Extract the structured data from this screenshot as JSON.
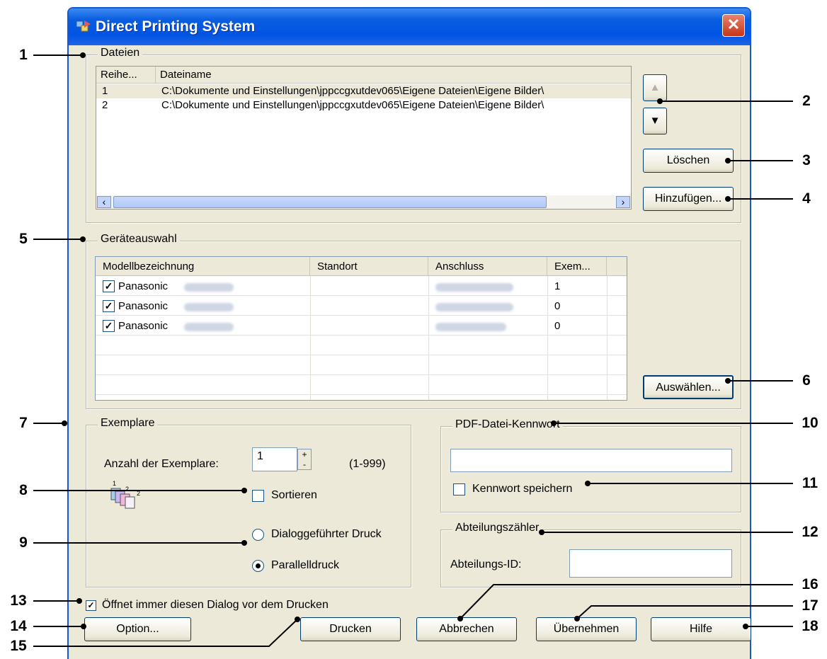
{
  "window": {
    "title": "Direct Printing System",
    "close": "✕"
  },
  "files": {
    "legend": "Dateien",
    "col_order": "Reihe...",
    "col_name": "Dateiname",
    "rows": [
      {
        "order": "1",
        "name": "C:\\Dokumente und Einstellungen\\jppccgxutdev065\\Eigene Dateien\\Eigene Bilder\\"
      },
      {
        "order": "2",
        "name": "C:\\Dokumente und Einstellungen\\jppccgxutdev065\\Eigene Dateien\\Eigene Bilder\\"
      }
    ],
    "scroll_left": "‹",
    "scroll_right": "›",
    "up": "▲",
    "down": "▼",
    "delete_label": "Löschen",
    "add_label": "Hinzufügen..."
  },
  "devices": {
    "legend": "Geräteauswahl",
    "cols": [
      "Modellbezeichnung",
      "Standort",
      "Anschluss",
      "Exem..."
    ],
    "rows": [
      {
        "model": "Panasonic",
        "copies": "1"
      },
      {
        "model": "Panasonic",
        "copies": "0"
      },
      {
        "model": "Panasonic",
        "copies": "0"
      }
    ],
    "select_label": "Auswählen..."
  },
  "copies": {
    "legend": "Exemplare",
    "count_label": "Anzahl der Exemplare:",
    "count_value": "1",
    "range": "(1-999)",
    "sort_label": "Sortieren",
    "dialog_label": "Dialoggeführter Druck",
    "parallel_label": "Parallelldruck"
  },
  "pdf": {
    "legend": "PDF-Datei-Kennwort",
    "save_label": "Kennwort speichern"
  },
  "dept": {
    "legend": "Abteilungszähler",
    "id_label": "Abteilungs-ID:"
  },
  "always_open_label": "Öffnet immer diesen Dialog vor dem Drucken",
  "buttons": {
    "option": "Option...",
    "print": "Drucken",
    "cancel": "Abbrechen",
    "apply": "Übernehmen",
    "help": "Hilfe"
  },
  "annotations": [
    "1",
    "2",
    "3",
    "4",
    "5",
    "6",
    "7",
    "8",
    "9",
    "10",
    "11",
    "12",
    "13",
    "14",
    "15",
    "16",
    "17",
    "18"
  ]
}
